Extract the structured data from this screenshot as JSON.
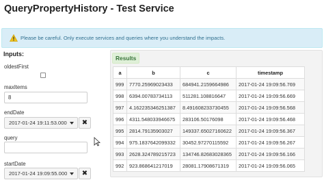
{
  "page": {
    "title": "QueryPropertyHistory - Test Service"
  },
  "alert": {
    "icon": "warning-icon",
    "text": "Please be careful. Only execute services and queries where you understand the impacts."
  },
  "inputs": {
    "title": "Inputs:",
    "oldestFirst": {
      "label": "oldestFirst",
      "checked": false
    },
    "maxItems": {
      "label": "maxItems",
      "value": "8"
    },
    "endDate": {
      "label": "endDate",
      "value": "2017-01-24 19:11:53.000"
    },
    "query": {
      "label": "query",
      "value": ""
    },
    "startDate": {
      "label": "startDate",
      "value": "2017-01-24 19:09:55.000"
    }
  },
  "results": {
    "tab_label": "Results",
    "columns": [
      "a",
      "b",
      "c",
      "timestamp"
    ],
    "rows": [
      [
        "999",
        "7770.25969023433",
        "684941.2159664986",
        "2017-01-24 19:09:56.769"
      ],
      [
        "998",
        "6394.00783734113",
        "511281.108816647",
        "2017-01-24 19:09:56.669"
      ],
      [
        "997",
        "4.162235346251387",
        "8.491608233730455",
        "2017-01-24 19:09:56.568"
      ],
      [
        "996",
        "4311.548033946675",
        "283106.50176098",
        "2017-01-24 19:09:56.468"
      ],
      [
        "995",
        "2814.79135903027",
        "149337.65027160622",
        "2017-01-24 19:09:56.367"
      ],
      [
        "994",
        "975.1837642099332",
        "30452.97270115592",
        "2017-01-24 19:09:56.267"
      ],
      [
        "993",
        "2628.324789215723",
        "134746.82683028365",
        "2017-01-24 19:09:56.166"
      ],
      [
        "992",
        "923.868641217019",
        "28081.17908671319",
        "2017-01-24 19:09:56.065"
      ]
    ]
  }
}
